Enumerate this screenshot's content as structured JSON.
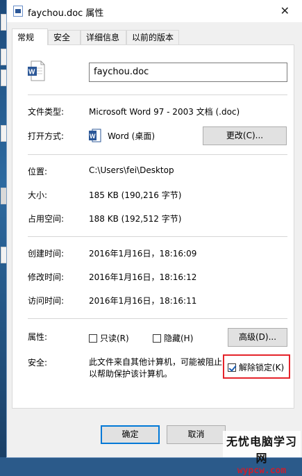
{
  "window": {
    "title": "faychou.doc 属性",
    "close_glyph": "✕"
  },
  "tabs": [
    {
      "label": "常规",
      "active": true
    },
    {
      "label": "安全",
      "active": false
    },
    {
      "label": "详细信息",
      "active": false
    },
    {
      "label": "以前的版本",
      "active": false
    }
  ],
  "general": {
    "file_name": "faychou.doc",
    "file_type_label": "文件类型:",
    "file_type_value": "Microsoft Word 97 - 2003 文档 (.doc)",
    "open_with_label": "打开方式:",
    "open_with_value": "Word (桌面)",
    "change_button": "更改(C)...",
    "location_label": "位置:",
    "location_value": "C:\\Users\\fei\\Desktop",
    "size_label": "大小:",
    "size_value": "185 KB (190,216 字节)",
    "disk_size_label": "占用空间:",
    "disk_size_value": "188 KB (192,512 字节)",
    "created_label": "创建时间:",
    "created_value": "2016年1月16日，18:16:09",
    "modified_label": "修改时间:",
    "modified_value": "2016年1月16日，18:16:12",
    "accessed_label": "访问时间:",
    "accessed_value": "2016年1月16日，18:16:11",
    "attributes_label": "属性:",
    "readonly_label": "只读(R)",
    "hidden_label": "隐藏(H)",
    "advanced_button": "高级(D)...",
    "security_label": "安全:",
    "security_text": "此文件来自其他计算机，可能被阻止以帮助保护该计算机。",
    "unblock_label": "解除锁定(K)",
    "unblock_checked": true,
    "readonly_checked": false,
    "hidden_checked": false
  },
  "footer": {
    "ok_button": "确定",
    "cancel_button": "取消"
  },
  "watermark": {
    "line1": "无忧电脑学习网",
    "line2": "wypcw.com"
  },
  "colors": {
    "highlight": "#e5232a",
    "accent": "#0078d7",
    "word_blue": "#2b5797"
  }
}
